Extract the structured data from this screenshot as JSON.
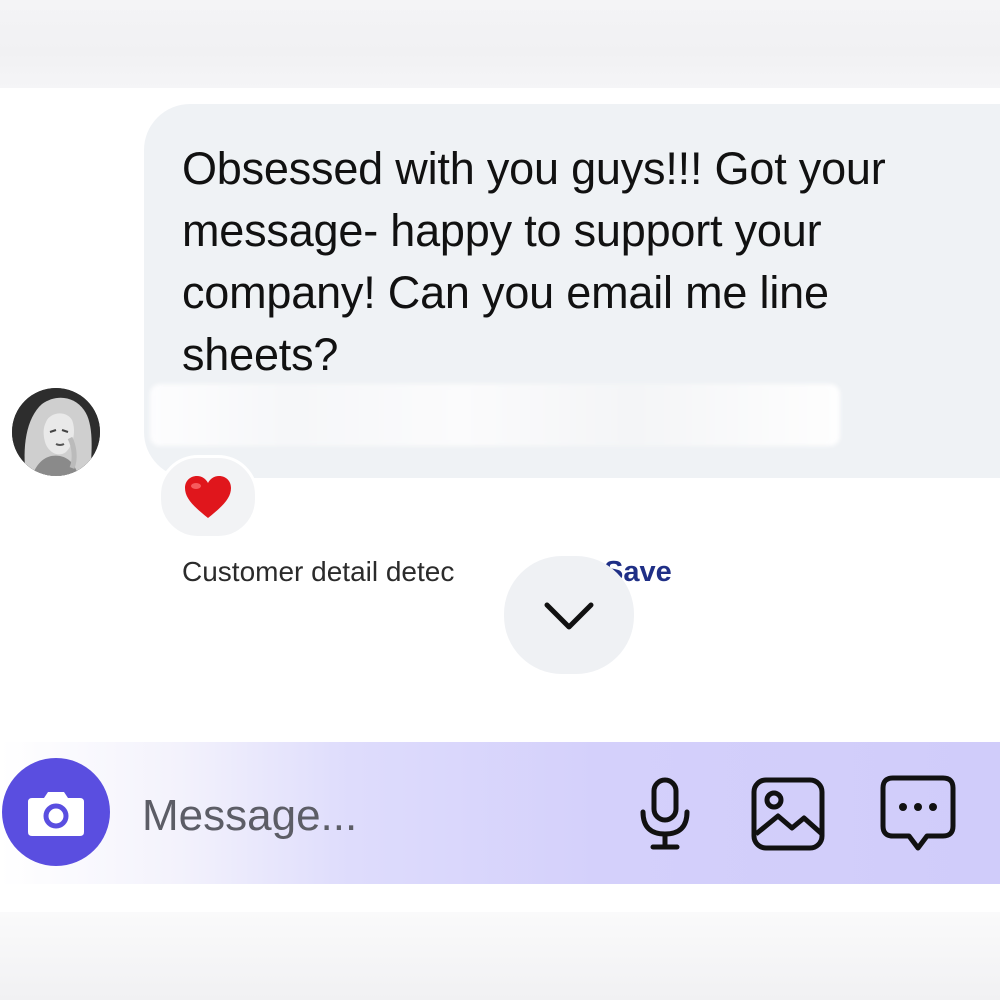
{
  "message": {
    "text": "Obsessed with you guys!!! Got your message- happy to support your company! Can you email me line sheets?",
    "reaction_emoji": "❤️"
  },
  "customer_detail": {
    "text": "Customer detail detec",
    "save_label": "Save"
  },
  "composer": {
    "placeholder": "Message..."
  },
  "icons": {
    "camera": "camera-icon",
    "microphone": "microphone-icon",
    "gallery": "image-icon",
    "more": "chat-bubble-more-icon",
    "scroll_down": "chevron-down-icon"
  },
  "colors": {
    "accent": "#5a4ee0",
    "link": "#1f2f86",
    "bubble": "#eff2f5",
    "composer_bar": "#d4d0fb"
  }
}
